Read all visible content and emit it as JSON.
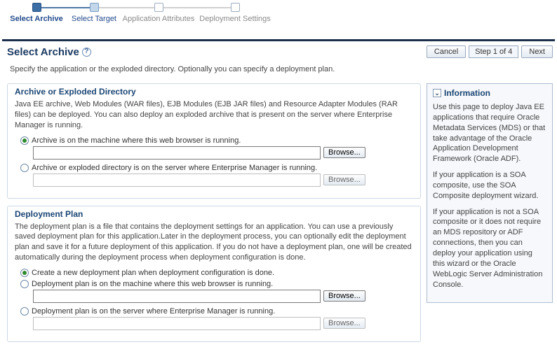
{
  "wizard": {
    "steps": [
      {
        "label": "Select Archive"
      },
      {
        "label": "Select Target"
      },
      {
        "label": "Application Attributes"
      },
      {
        "label": "Deployment Settings"
      }
    ]
  },
  "header": {
    "title": "Select Archive",
    "cancel": "Cancel",
    "step_indicator": "Step 1 of 4",
    "next": "Next"
  },
  "description": "Specify the application or the exploded directory. Optionally you can specify a deployment plan.",
  "archive_section": {
    "title": "Archive or Exploded Directory",
    "text": "Java EE archive, Web Modules (WAR files), EJB Modules (EJB JAR files) and Resource Adapter Modules (RAR files) can be deployed. You can also deploy an exploded archive that is present on the server where Enterprise Manager is running.",
    "option_local": "Archive is on the machine where this web browser is running.",
    "option_server": "Archive or exploded directory is on the server where Enterprise Manager is running.",
    "browse": "Browse...",
    "local_value": "",
    "server_value": ""
  },
  "plan_section": {
    "title": "Deployment Plan",
    "text": "The deployment plan is a file that contains the deployment settings for an application. You can use a previously saved deployment plan for this application.Later in the deployment process, you can optionally edit the deployment plan and save it for a future deployment of this application. If you do not have a deployment plan, one will be created automatically during the deployment process when deployment configuration is done.",
    "option_create": "Create a new deployment plan when deployment configuration is done.",
    "option_local": "Deployment plan is on the machine where this web browser is running.",
    "option_server": "Deployment plan is on the server where Enterprise Manager is running.",
    "browse": "Browse...",
    "local_value": "",
    "server_value": ""
  },
  "info": {
    "title": "Information",
    "p1": "Use this page to deploy Java EE applications that require Oracle Metadata Services (MDS) or that take advantage of the Oracle Application Development Framework (Oracle ADF).",
    "p2": "If your application is a SOA composite, use the SOA Composite deployment wizard.",
    "p3": "If your application is not a SOA composite or it does not require an MDS repository or ADF connections, then you can deploy your application using this wizard or the Oracle WebLogic Server Administration Console."
  }
}
